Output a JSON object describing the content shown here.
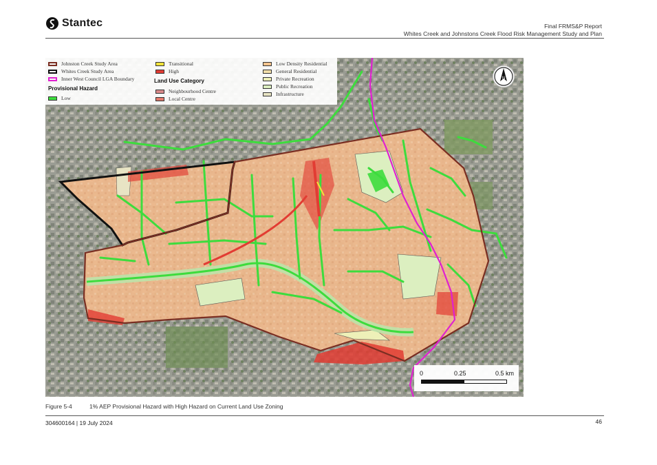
{
  "header": {
    "logo_text": "Stantec",
    "report_title": "Final FRMS&P Report",
    "report_subtitle": "Whites Creek and Johnstons Creek Flood Risk Management Study and Plan"
  },
  "legend": {
    "col1": [
      {
        "label": "Johnston Creek Study Area",
        "color": "#7a2e22"
      },
      {
        "label": "Whites Creek Study Area",
        "color": "#111111"
      },
      {
        "label": "Inner West Council LGA Boundary",
        "color": "#e020d0"
      }
    ],
    "provisional_hazard_heading": "Provisional Hazard",
    "hazard": [
      {
        "label": "Low",
        "color": "#3ddc3d"
      },
      {
        "label": "Transitional",
        "color": "#f2e33a"
      },
      {
        "label": "High",
        "color": "#e23c33"
      }
    ],
    "land_use_heading": "Land Use Category",
    "land_use_mid": [
      {
        "label": "Neighbourhood Centre",
        "color": "#d98a8a"
      },
      {
        "label": "Local Centre",
        "color": "#e47a6c"
      }
    ],
    "land_use_right": [
      {
        "label": "Low Density Residential",
        "color": "#f5c58e"
      },
      {
        "label": "General Residential",
        "color": "#f2dfaa"
      },
      {
        "label": "Private Recreation",
        "color": "#eef0b8"
      },
      {
        "label": "Public Recreation",
        "color": "#dcefc0"
      },
      {
        "label": "Infrastructure",
        "color": "#e8e4c4"
      }
    ]
  },
  "scale_bar": {
    "labels": [
      "0",
      "0.25",
      "0.5 km"
    ]
  },
  "north_arrow": {
    "label": "N"
  },
  "caption": {
    "number": "Figure 5-4",
    "text": "1% AEP Provisional Hazard with High Hazard on Current Land Use Zoning"
  },
  "footer": {
    "doc_ref": "304600164 | 19 July 2024",
    "page_number": "46"
  }
}
